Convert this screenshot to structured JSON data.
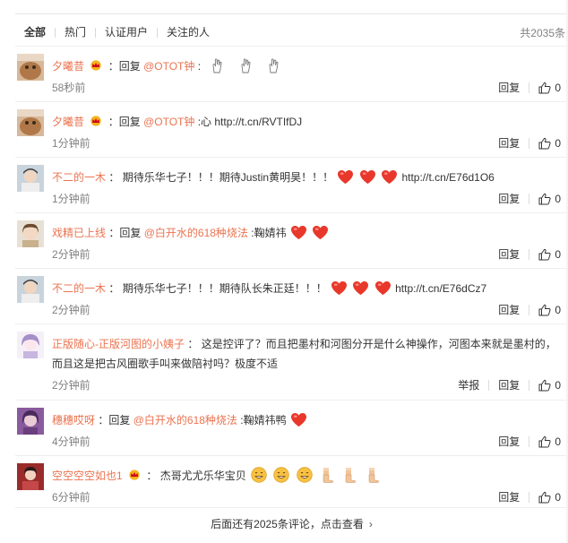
{
  "tabs": [
    "全部",
    "热门",
    "认证用户",
    "关注的人"
  ],
  "total": "共2035条",
  "actions": {
    "reply": "回复",
    "report": "举报"
  },
  "comments": [
    {
      "user": "夕曦昔",
      "prefix": "：回复",
      "mention": "@OTOT钟",
      "text": ":",
      "link": "",
      "time": "58秒前",
      "likes": "0"
    },
    {
      "user": "夕曦昔",
      "prefix": "：回复",
      "mention": "@OTOT钟",
      "text": ":心 ",
      "link": "http://t.cn/RVTIfDJ",
      "time": "1分钟前",
      "likes": "0"
    },
    {
      "user": "不二的一木",
      "prefix": "：",
      "text": "期待乐华七子！！！期待Justin黄明昊！！！",
      "link": "http://t.cn/E76d1O6",
      "time": "1分钟前",
      "likes": "0"
    },
    {
      "user": "戏精已上线",
      "prefix": "：回复",
      "mention": "@白开水的618种烧法",
      "text": ":鞠婧祎",
      "time": "2分钟前",
      "likes": "0"
    },
    {
      "user": "不二的一木",
      "prefix": "：",
      "text": "期待乐华七子！！！期待队长朱正廷！！！",
      "link": "http://t.cn/E76dCz7",
      "time": "2分钟前",
      "likes": "0"
    },
    {
      "user": "正版随心-正版河图的小姨子",
      "prefix": "：",
      "text": "这是控评了？而且把墨村和河图分开是什么神操作，河图本来就是墨村的，",
      "text2": "而且这是把古风圈歌手叫来做陪衬吗？极度不适",
      "time": "2分钟前",
      "likes": "0"
    },
    {
      "user": "穗穗哎呀",
      "prefix": "：回复",
      "mention": "@白开水的618种烧法",
      "text": ":鞠婧祎鸭",
      "time": "4分钟前",
      "likes": "0"
    },
    {
      "user": "空空空空如也1",
      "prefix": "：",
      "text": "杰哥尤尤乐华宝贝",
      "time": "6分钟前",
      "likes": "0"
    }
  ],
  "more": "后面还有2025条评论，点击查看",
  "colors": {
    "username": "#eb7350",
    "muted": "#808080",
    "heart": "#e8382b"
  },
  "icons": [
    "crown-icon",
    "thumbs-up-icon",
    "heart-icon",
    "hand-icon",
    "grin-icon",
    "thumb-icon",
    "chevron-right-icon"
  ]
}
